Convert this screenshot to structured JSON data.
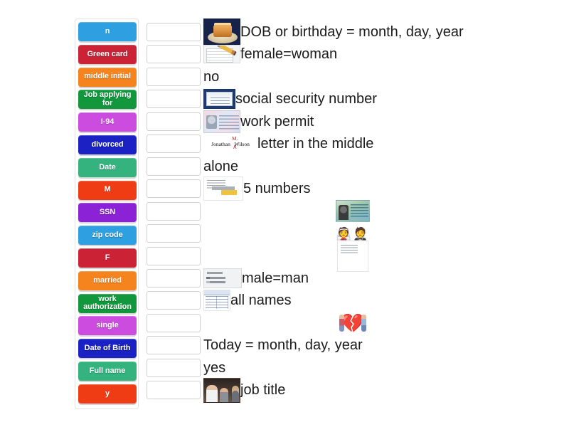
{
  "activity": {
    "type": "match-up",
    "tile_panel_name": "draggable-answer-tiles"
  },
  "tiles": [
    {
      "label": "n",
      "color": "#2e9fe0"
    },
    {
      "label": "Green card",
      "color": "#cc2236"
    },
    {
      "label": "middle initial",
      "color": "#f5841f"
    },
    {
      "label": "Job applying for",
      "color": "#12973d"
    },
    {
      "label": "I-94",
      "color": "#cc4ce0"
    },
    {
      "label": "divorced",
      "color": "#1a22c4"
    },
    {
      "label": "Date",
      "color": "#34b37e"
    },
    {
      "label": "M",
      "color": "#f03c14"
    },
    {
      "label": "SSN",
      "color": "#8b22d6"
    },
    {
      "label": "zip code",
      "color": "#2e9fe0"
    },
    {
      "label": "F",
      "color": "#cc2236"
    },
    {
      "label": "married",
      "color": "#f5841f"
    },
    {
      "label": "work authorization",
      "color": "#12973d"
    },
    {
      "label": "single",
      "color": "#cc4ce0"
    },
    {
      "label": "Date of Birth",
      "color": "#1a22c4"
    },
    {
      "label": "Full name",
      "color": "#34b37e"
    },
    {
      "label": "y",
      "color": "#f03c14"
    }
  ],
  "prompts": [
    {
      "text": "DOB or birthday = month, day, year",
      "image": "birthday-cake-photo",
      "layout": "left"
    },
    {
      "text": "female=woman",
      "image": "form-and-pencil-photo",
      "layout": "left"
    },
    {
      "text": "no",
      "image": "",
      "layout": "left"
    },
    {
      "text": "social security number",
      "image": "social-security-card-photo",
      "layout": "left"
    },
    {
      "text": "work permit",
      "image": "work-permit-card-photo",
      "layout": "left"
    },
    {
      "text": "letter in the middle",
      "image": "signature-middle-initial",
      "layout": "left"
    },
    {
      "text": "alone",
      "image": "",
      "layout": "left"
    },
    {
      "text": "5 numbers",
      "image": "zip-code-letter-photo",
      "layout": "left"
    },
    {
      "text": "",
      "image": "green-card-photo",
      "layout": "center"
    },
    {
      "text": "",
      "image": "bride-and-groom-emoji",
      "layout": "center"
    },
    {
      "text": "",
      "image": "certificate-document-photo",
      "layout": "center"
    },
    {
      "text": "male=man",
      "image": "gender-radio-form-photo",
      "layout": "left"
    },
    {
      "text": "all names",
      "image": "names-spreadsheet-photo",
      "layout": "left"
    },
    {
      "text": "",
      "image": "broken-heart-divorce-photo",
      "layout": "center"
    },
    {
      "text": "Today = month, day, year",
      "image": "",
      "layout": "left"
    },
    {
      "text": "yes",
      "image": "",
      "layout": "left"
    },
    {
      "text": "job title",
      "image": "business-people-photo",
      "layout": "left"
    }
  ],
  "emoji": {
    "bride": "👰",
    "groom": "🤵",
    "broken_heart": "💔"
  },
  "signature": {
    "first": "Jonathan",
    "middle": "M.",
    "last": "Wilson",
    "caret": "∧"
  },
  "colors": {
    "tile_border": "#e2e2e2",
    "dropbox_border": "#cfcfcf",
    "text": "#1c1c1c"
  }
}
